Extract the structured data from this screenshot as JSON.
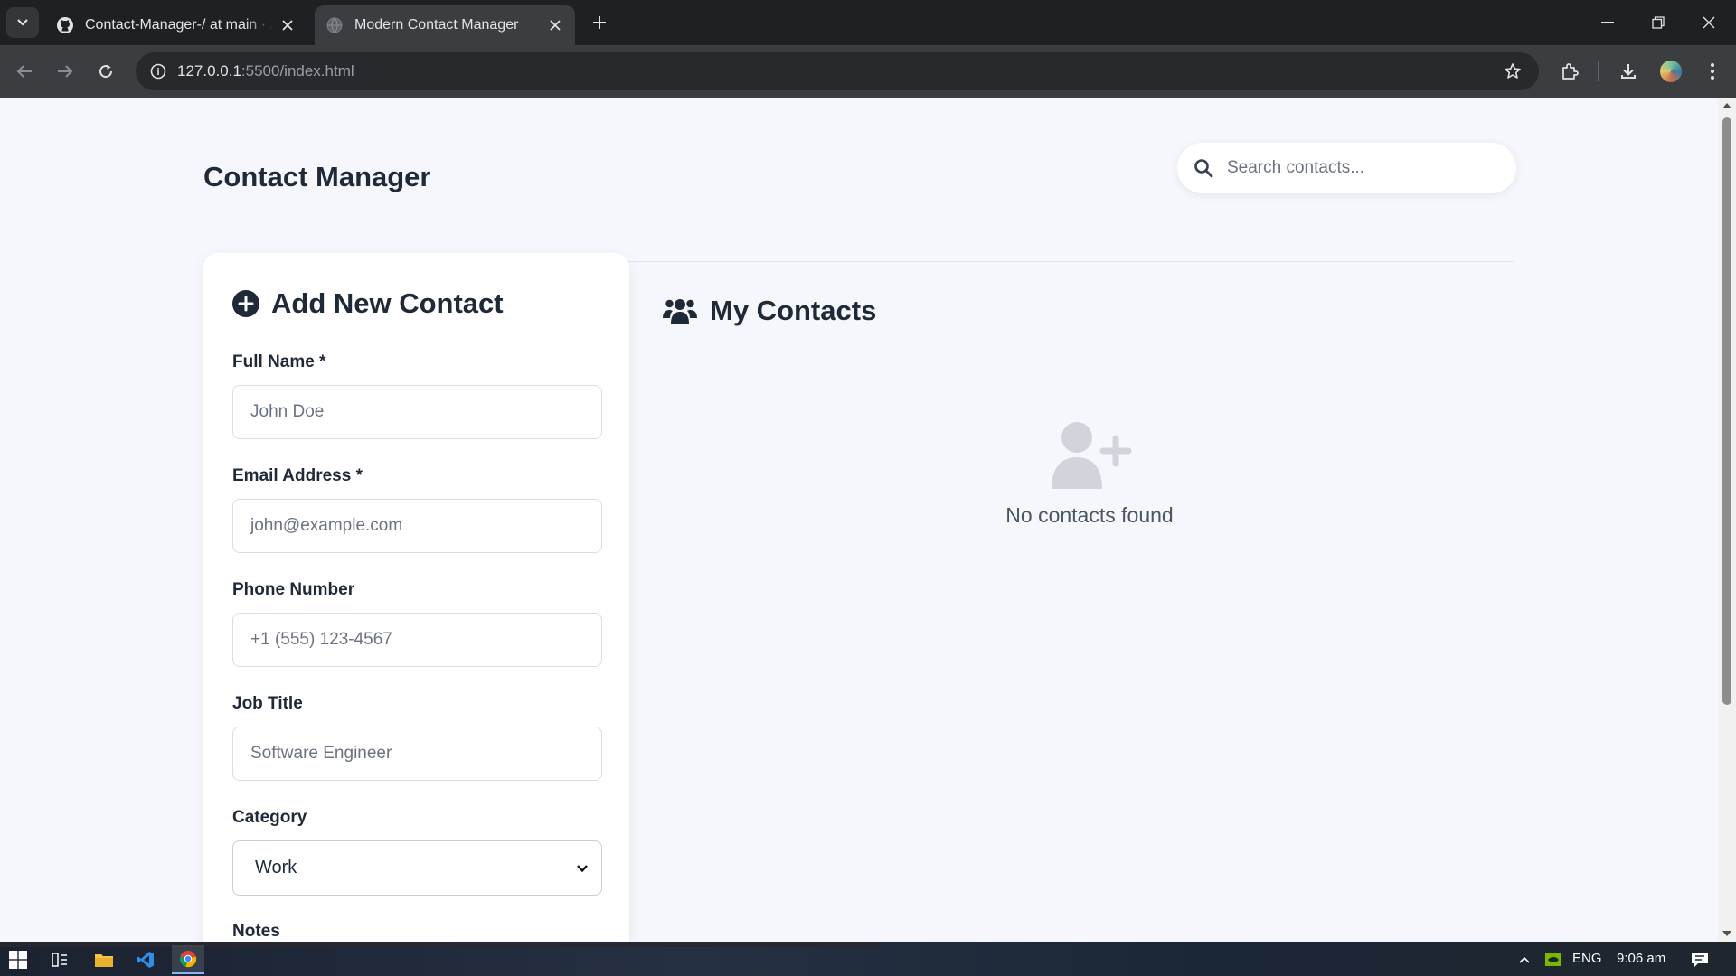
{
  "browser": {
    "tabs": [
      {
        "title": "Contact-Manager-/ at main · Za",
        "icon": "github-icon",
        "active": false
      },
      {
        "title": "Modern Contact Manager",
        "icon": "globe-icon",
        "active": true
      }
    ],
    "url_host": "127.0.0.1",
    "url_rest": ":5500/index.html"
  },
  "header": {
    "title": "Contact Manager",
    "search_placeholder": "Search contacts..."
  },
  "form": {
    "title": "Add New Contact",
    "fields": [
      {
        "label": "Full Name *",
        "placeholder": "John Doe"
      },
      {
        "label": "Email Address *",
        "placeholder": "john@example.com"
      },
      {
        "label": "Phone Number",
        "placeholder": "+1 (555) 123-4567"
      },
      {
        "label": "Job Title",
        "placeholder": "Software Engineer"
      }
    ],
    "category_label": "Category",
    "category_value": "Work",
    "notes_label": "Notes"
  },
  "contacts": {
    "title": "My Contacts",
    "empty_message": "No contacts found"
  },
  "taskbar": {
    "language": "ENG",
    "time": "9:06 am"
  },
  "colors": {
    "page_bg": "#f5f7fc",
    "text_primary": "#1f2937",
    "icon_muted": "#d1d5db"
  }
}
